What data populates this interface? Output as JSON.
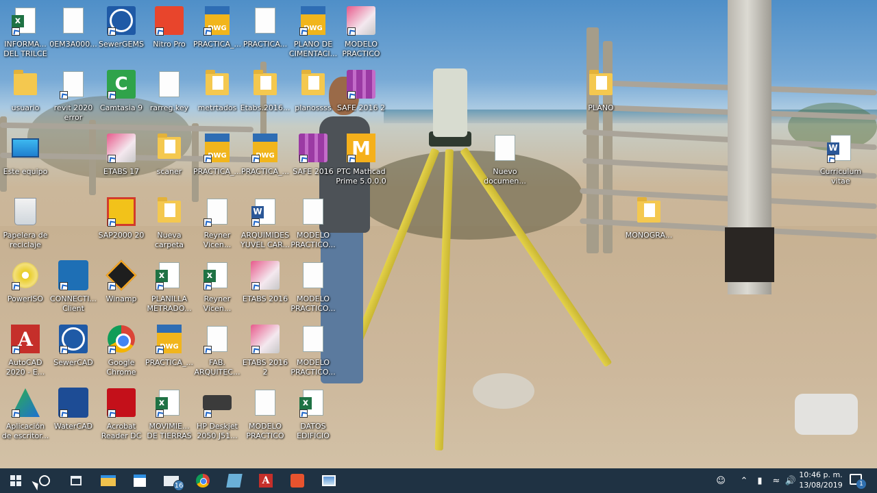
{
  "desktop": {
    "icons": [
      {
        "label": "INFORMA...\nDEL TRILCE",
        "icon": "excel-icon"
      },
      {
        "label": "0EM3A000...",
        "icon": "document-icon"
      },
      {
        "label": "SewerGEMS",
        "icon": "sewergems-icon"
      },
      {
        "label": "Nitro Pro",
        "icon": "nitro-pro-icon"
      },
      {
        "label": "PRACTICA_...",
        "icon": "dwg-icon"
      },
      {
        "label": "PRACTICA...",
        "icon": "document-icon"
      },
      {
        "label": "PLANO DE\nCIMENTACI...",
        "icon": "dwg-icon"
      },
      {
        "label": "MODELO\nPRACTICO",
        "icon": "etabs-icon"
      },
      {
        "label": "usuario",
        "icon": "user-folder-icon"
      },
      {
        "label": "revit 2020\nerror",
        "icon": "image-icon"
      },
      {
        "label": "Camtasia 9",
        "icon": "camtasia-icon"
      },
      {
        "label": "rarreg.key",
        "icon": "document-icon"
      },
      {
        "label": "metrtados",
        "icon": "folder-icon"
      },
      {
        "label": "Etabs.2016...",
        "icon": "folder-icon"
      },
      {
        "label": "planossss",
        "icon": "folder-icon"
      },
      {
        "label": "SAFE 2016 2",
        "icon": "safe-icon"
      },
      {
        "label": "PLANO",
        "icon": "folder-icon"
      },
      {
        "label": "Este equipo",
        "icon": "this-pc-icon"
      },
      {
        "label": "ETABS 17",
        "icon": "etabs-icon"
      },
      {
        "label": "scaner",
        "icon": "folder-icon"
      },
      {
        "label": "PRACTICA_...",
        "icon": "dwg-icon"
      },
      {
        "label": "PRACTICA_...",
        "icon": "dwg-icon"
      },
      {
        "label": "SAFE 2016",
        "icon": "safe-icon"
      },
      {
        "label": "PTC Mathcad\nPrime 5.0.0.0",
        "icon": "mathcad-icon"
      },
      {
        "label": "Nuevo\ndocumen...",
        "icon": "text-document-icon"
      },
      {
        "label": "Curriculum\nvitae",
        "icon": "word-icon"
      },
      {
        "label": "Papelera de\nreciclaje",
        "icon": "recycle-bin-icon"
      },
      {
        "label": "SAP2000 20",
        "icon": "sap2000-icon"
      },
      {
        "label": "Nueva\ncarpeta",
        "icon": "folder-icon"
      },
      {
        "label": "Reyner\nVicen...",
        "icon": "image-icon"
      },
      {
        "label": "ARQUIMIDES\nYUVEL CAR...",
        "icon": "word-icon"
      },
      {
        "label": "MODELO\nPRACTICO...",
        "icon": "document-icon"
      },
      {
        "label": "MONOGRA...",
        "icon": "folder-icon"
      },
      {
        "label": "PowerISO",
        "icon": "poweriso-icon"
      },
      {
        "label": "CONNECTI...\nClient",
        "icon": "connect-client-icon"
      },
      {
        "label": "Winamp",
        "icon": "winamp-icon"
      },
      {
        "label": "PLANILLA\nMETRADO...",
        "icon": "excel-icon"
      },
      {
        "label": "Reyner\nVicen...",
        "icon": "excel-icon"
      },
      {
        "label": "ETABS 2016",
        "icon": "etabs-icon"
      },
      {
        "label": "MODELO\nPRACTICO...",
        "icon": "document-icon"
      },
      {
        "label": "AutoCAD\n2020 - E...",
        "icon": "autocad-icon"
      },
      {
        "label": "SewerCAD",
        "icon": "sewercad-icon"
      },
      {
        "label": "Google\nChrome",
        "icon": "chrome-icon"
      },
      {
        "label": "PRACTICA_...",
        "icon": "dwg-icon"
      },
      {
        "label": "FAB.\nARQUITEC...",
        "icon": "image-icon"
      },
      {
        "label": "ETABS 2016 2",
        "icon": "etabs-icon"
      },
      {
        "label": "MODELO\nPRACTICO...",
        "icon": "document-icon"
      },
      {
        "label": "Aplicación\nde escritor...",
        "icon": "desktop-app-icon"
      },
      {
        "label": "WaterCAD",
        "icon": "watercad-icon"
      },
      {
        "label": "Acrobat\nReader DC",
        "icon": "acrobat-icon"
      },
      {
        "label": "MOVIMIE...\nDE TIERRAS",
        "icon": "excel-icon"
      },
      {
        "label": "HP Deskjet\n2050 J51...",
        "icon": "printer-icon"
      },
      {
        "label": "MODELO\nPRACTICO",
        "icon": "document-icon"
      },
      {
        "label": "DATOS\nEDIFICIO",
        "icon": "excel-icon"
      }
    ]
  },
  "taskbar": {
    "items": [
      {
        "name": "start-button",
        "icon": "windows-icon"
      },
      {
        "name": "cortana-button",
        "icon": "cortana-icon"
      },
      {
        "name": "task-view-button",
        "icon": "task-view-icon"
      },
      {
        "name": "file-explorer-button",
        "icon": "folder-icon"
      },
      {
        "name": "store-button",
        "icon": "store-icon"
      },
      {
        "name": "mail-button",
        "icon": "mail-icon",
        "badge": "16"
      },
      {
        "name": "chrome-button",
        "icon": "chrome-icon"
      },
      {
        "name": "app-button",
        "icon": "app-icon"
      },
      {
        "name": "acrobat-button",
        "icon": "acrobat-icon"
      },
      {
        "name": "camtasia-button",
        "icon": "camtasia-icon"
      },
      {
        "name": "photos-button",
        "icon": "photos-icon"
      }
    ],
    "tray": {
      "time": "10:46 p. m.",
      "date": "13/08/2019",
      "notification_count": "1"
    }
  }
}
